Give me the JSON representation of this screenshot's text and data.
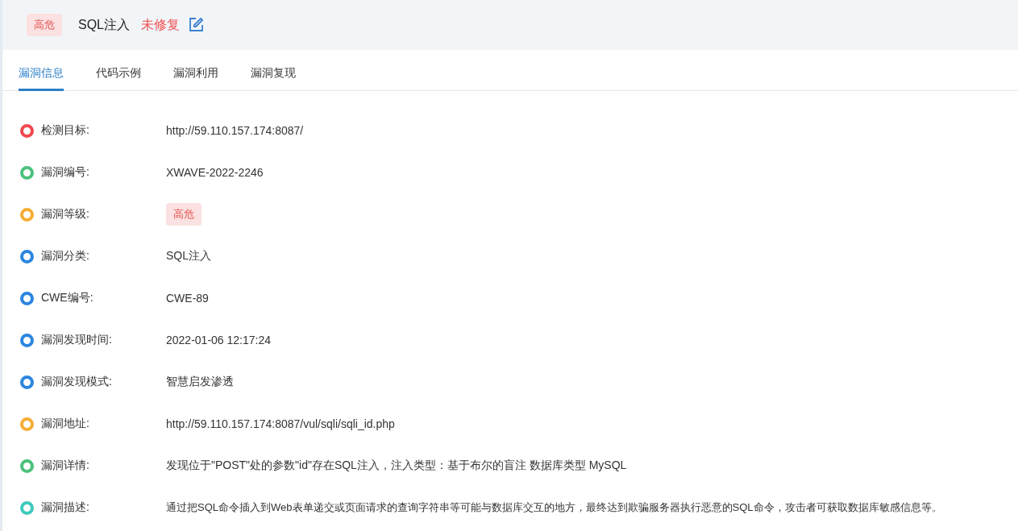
{
  "header": {
    "severity": "高危",
    "title": "SQL注入",
    "status": "未修复"
  },
  "tabs": [
    {
      "label": "漏洞信息",
      "selected": true
    },
    {
      "label": "代码示例",
      "selected": false
    },
    {
      "label": "漏洞利用",
      "selected": false
    },
    {
      "label": "漏洞复现",
      "selected": false
    }
  ],
  "fields": [
    {
      "label": "检测目标:",
      "value": "http://59.110.157.174:8087/",
      "kind": "text",
      "color": "#f0484f"
    },
    {
      "label": "漏洞编号:",
      "value": "XWAVE-2022-2246",
      "kind": "text",
      "color": "#4cc17c"
    },
    {
      "label": "漏洞等级:",
      "value": "高危",
      "kind": "tag",
      "color": "#f6ad35"
    },
    {
      "label": "漏洞分类:",
      "value": "SQL注入",
      "kind": "text",
      "color": "#2b86e0"
    },
    {
      "label": "CWE编号:",
      "value": "CWE-89",
      "kind": "text",
      "color": "#2b86e0"
    },
    {
      "label": "漏洞发现时间:",
      "value": "2022-01-06 12:17:24",
      "kind": "text",
      "color": "#2b86e0"
    },
    {
      "label": "漏洞发现模式:",
      "value": "智慧启发渗透",
      "kind": "text",
      "color": "#2b86e0"
    },
    {
      "label": "漏洞地址:",
      "value": "http://59.110.157.174:8087/vul/sqli/sqli_id.php",
      "kind": "text",
      "color": "#f6ad35"
    },
    {
      "label": "漏洞详情:",
      "value": "发现位于\"POST\"处的参数\"id\"存在SQL注入，注入类型：基于布尔的盲注 数据库类型 MySQL",
      "kind": "text",
      "color": "#4cc17c"
    },
    {
      "label": "漏洞描述:",
      "value": "通过把SQL命令插入到Web表单递交或页面请求的查询字符串等可能与数据库交互的地方，最终达到欺骗服务器执行恶意的SQL命令，攻击者可获取数据库敏感信息等。",
      "kind": "text",
      "color": "#3fcabc"
    }
  ]
}
